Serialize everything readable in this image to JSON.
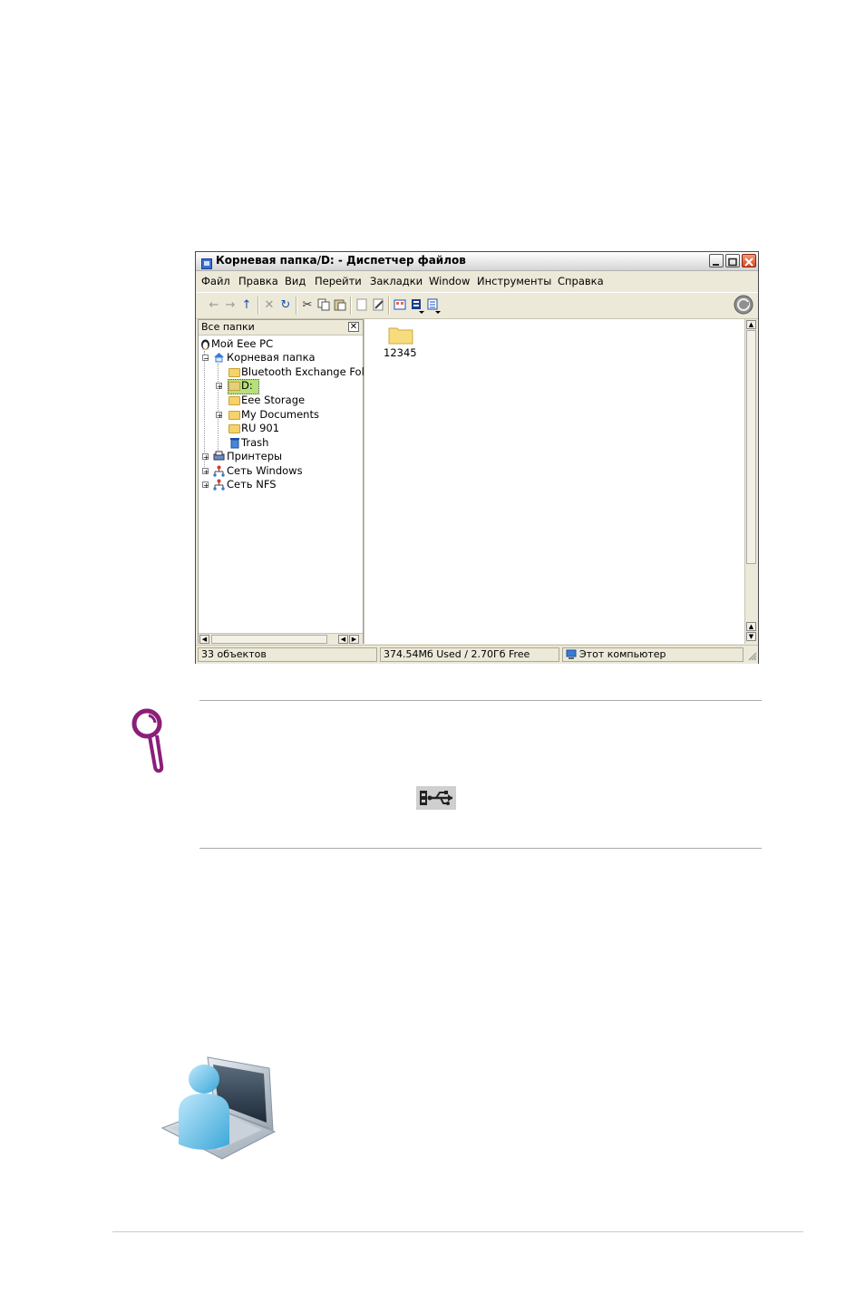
{
  "window": {
    "title": "Корневая папка/D: - Диспетчер файлов",
    "menu": [
      "Файл",
      "Правка",
      "Вид",
      "Перейти",
      "Закладки",
      "Window",
      "Инструменты",
      "Справка"
    ],
    "toolbar_icons": [
      "back-arrow-icon",
      "forward-arrow-icon",
      "up-arrow-icon",
      "delete-icon",
      "refresh-icon",
      "cut-icon",
      "copy-icon",
      "paste-icon",
      "new-file-icon",
      "rename-icon",
      "icon-view-icon",
      "detail-view-icon",
      "list-view-icon",
      "busy-spinner-icon"
    ]
  },
  "left_panel": {
    "header": "Все папки",
    "tree": [
      {
        "label": "Мой Eee PC",
        "icon": "penguin-icon"
      },
      {
        "label": "Корневая папка",
        "icon": "home-icon"
      },
      {
        "label": "Bluetooth Exchange Fold",
        "icon": "folder-icon"
      },
      {
        "label": "D:",
        "icon": "drive-icon"
      },
      {
        "label": "Eee Storage",
        "icon": "folder-icon"
      },
      {
        "label": "My Documents",
        "icon": "folder-icon"
      },
      {
        "label": "RU 901",
        "icon": "folder-icon"
      },
      {
        "label": "Trash",
        "icon": "trash-icon"
      },
      {
        "label": "Принтеры",
        "icon": "printer-icon"
      },
      {
        "label": "Сеть Windows",
        "icon": "network-icon"
      },
      {
        "label": "Сеть NFS",
        "icon": "network-icon"
      }
    ]
  },
  "right_panel": {
    "items": [
      {
        "label": "12345",
        "icon": "folder-icon"
      }
    ]
  },
  "status": {
    "count": "33 объектов",
    "space": "374.54Мб Used / 2.70Гб Free",
    "location": "Этот компьютер"
  },
  "colors": {
    "magnifier": "#8b1e7a",
    "selection": "#b6e07a"
  }
}
